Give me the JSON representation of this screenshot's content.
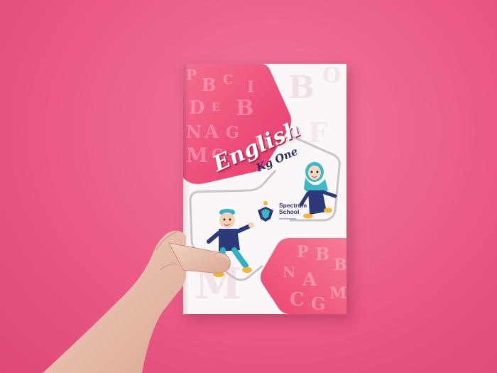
{
  "scene": {
    "background_color": "#ea5b86",
    "book_color": "#fbf6f7",
    "accent_pink": "#f04a73",
    "navy": "#2b3266"
  },
  "cover": {
    "title": "English",
    "subtitle": "Kg One",
    "school_name_line1": "Spectrum",
    "school_name_line2": "School",
    "school_tagline": "Ilmi Muhtarmah"
  },
  "decoration_letters": [
    "B",
    "B",
    "B",
    "P",
    "N",
    "A",
    "M",
    "C",
    "G",
    "D",
    "B",
    "P",
    "E",
    "N",
    "A",
    "M",
    "C",
    "B",
    "I"
  ]
}
